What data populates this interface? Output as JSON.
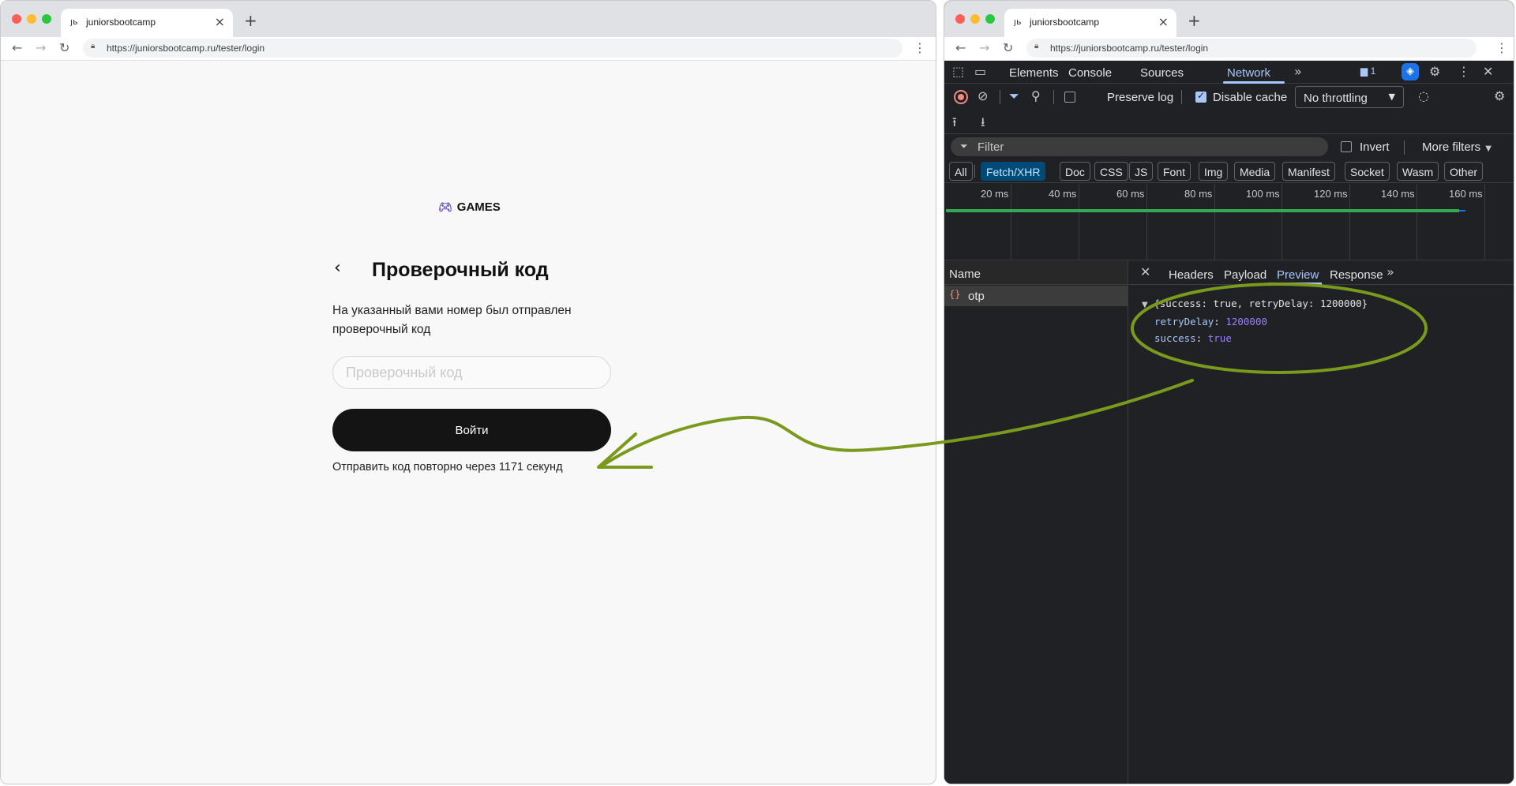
{
  "left_browser": {
    "tab_title": "juniorsbootcamp",
    "url": "https://juniorsbootcamp.ru/tester/login"
  },
  "right_browser": {
    "tab_title": "juniorsbootcamp",
    "url": "https://juniorsbootcamp.ru/tester/login"
  },
  "login_page": {
    "brand": "GAMES",
    "title": "Проверочный код",
    "description": "На указанный вами номер был отправлен проверочный код",
    "code_placeholder": "Проверочный код",
    "code_value": "",
    "submit_label": "Войти",
    "resend_text": "Отправить код повторно через 1171 секунд"
  },
  "devtools": {
    "panel_tabs": [
      "Elements",
      "Console",
      "Sources",
      "Network"
    ],
    "active_panel": "Network",
    "issues_badge": "1",
    "preserve_log_label": "Preserve log",
    "preserve_log_checked": false,
    "disable_cache_label": "Disable cache",
    "disable_cache_checked": true,
    "throttling": "No throttling",
    "filter_placeholder": "Filter",
    "invert_label": "Invert",
    "more_filters_label": "More filters",
    "type_filters": [
      "All",
      "Fetch/XHR",
      "Doc",
      "CSS",
      "JS",
      "Font",
      "Img",
      "Media",
      "Manifest",
      "Socket",
      "Wasm",
      "Other"
    ],
    "active_type_filter": "Fetch/XHR",
    "timeline_ticks": [
      "20 ms",
      "40 ms",
      "60 ms",
      "80 ms",
      "100 ms",
      "120 ms",
      "140 ms",
      "160 ms"
    ],
    "name_column": "Name",
    "requests": [
      {
        "name": "otp"
      }
    ],
    "detail_tabs": [
      "Headers",
      "Payload",
      "Preview",
      "Response"
    ],
    "active_detail_tab": "Preview",
    "preview": {
      "summary": "{success: true, retryDelay: 1200000}",
      "rows": [
        {
          "key": "retryDelay",
          "value": "1200000"
        },
        {
          "key": "success",
          "value": "true"
        }
      ]
    }
  },
  "colors": {
    "accent_blue": "#a8c7fa",
    "annotation_green": "#7a9a1e",
    "button_dark": "#141414"
  },
  "icons": [
    "gamepad-icon",
    "back-chevron-icon",
    "record-icon",
    "clear-icon",
    "filter-icon",
    "search-icon",
    "settings-icon",
    "close-icon",
    "upload-icon",
    "download-icon"
  ]
}
